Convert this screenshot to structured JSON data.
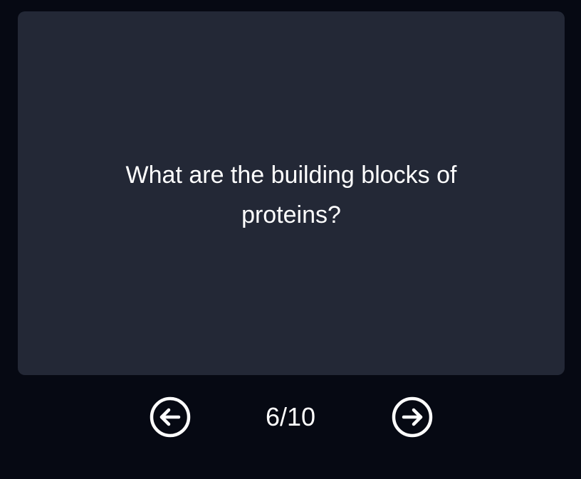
{
  "flashcard": {
    "question": "What are the building blocks of proteins?"
  },
  "navigation": {
    "prev_icon": "arrow-left-circle-icon",
    "next_icon": "arrow-right-circle-icon",
    "counter": "6/10",
    "current": 6,
    "total": 10
  },
  "colors": {
    "background": "#060913",
    "card": "#232836",
    "text": "#ffffff"
  }
}
